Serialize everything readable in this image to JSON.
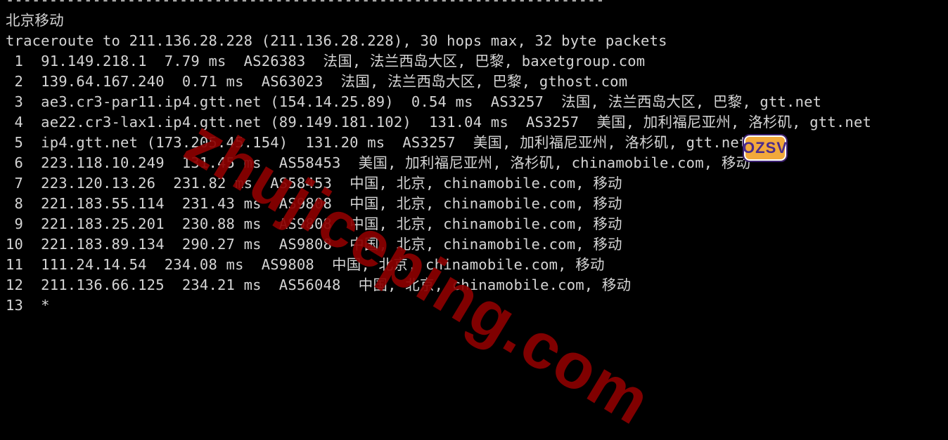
{
  "terminal": {
    "separator": "---------------------------------------------------------------------",
    "section_title": "北京移动",
    "header": "traceroute to 211.136.28.228 (211.136.28.228), 30 hops max, 32 byte packets",
    "hops": [
      " 1  91.149.218.1  7.79 ms  AS26383  法国, 法兰西岛大区, 巴黎, baxetgroup.com",
      " 2  139.64.167.240  0.71 ms  AS63023  法国, 法兰西岛大区, 巴黎, gthost.com",
      " 3  ae3.cr3-par11.ip4.gtt.net (154.14.25.89)  0.54 ms  AS3257  法国, 法兰西岛大区, 巴黎, gtt.net",
      " 4  ae22.cr3-lax1.ip4.gtt.net (89.149.181.102)  131.04 ms  AS3257  美国, 加利福尼亚州, 洛杉矶, gtt.net",
      " 5  ip4.gtt.net (173.205.45.154)  131.20 ms  AS3257  美国, 加利福尼亚州, 洛杉矶, gtt.net",
      " 6  223.118.10.249  131.45 ms  AS58453  美国, 加利福尼亚州, 洛杉矶, chinamobile.com, 移动",
      " 7  223.120.13.26  231.82 ms  AS58453  中国, 北京, chinamobile.com, 移动",
      " 8  221.183.55.114  231.43 ms  AS9808  中国, 北京, chinamobile.com, 移动",
      " 9  221.183.25.201  230.88 ms  AS9808  中国, 北京, chinamobile.com, 移动",
      "10  221.183.89.134  290.27 ms  AS9808  中国, 北京, chinamobile.com, 移动",
      "11  111.24.14.54  234.08 ms  AS9808  中国, 北京, chinamobile.com, 移动",
      "12  211.136.66.125  234.21 ms  AS56048  中国, 北京, chinamobile.com, 移动",
      "13  *"
    ]
  },
  "watermark": {
    "text": "zhujiceping.com",
    "color": "#8b0000"
  },
  "logo": {
    "text": "OZSV"
  }
}
